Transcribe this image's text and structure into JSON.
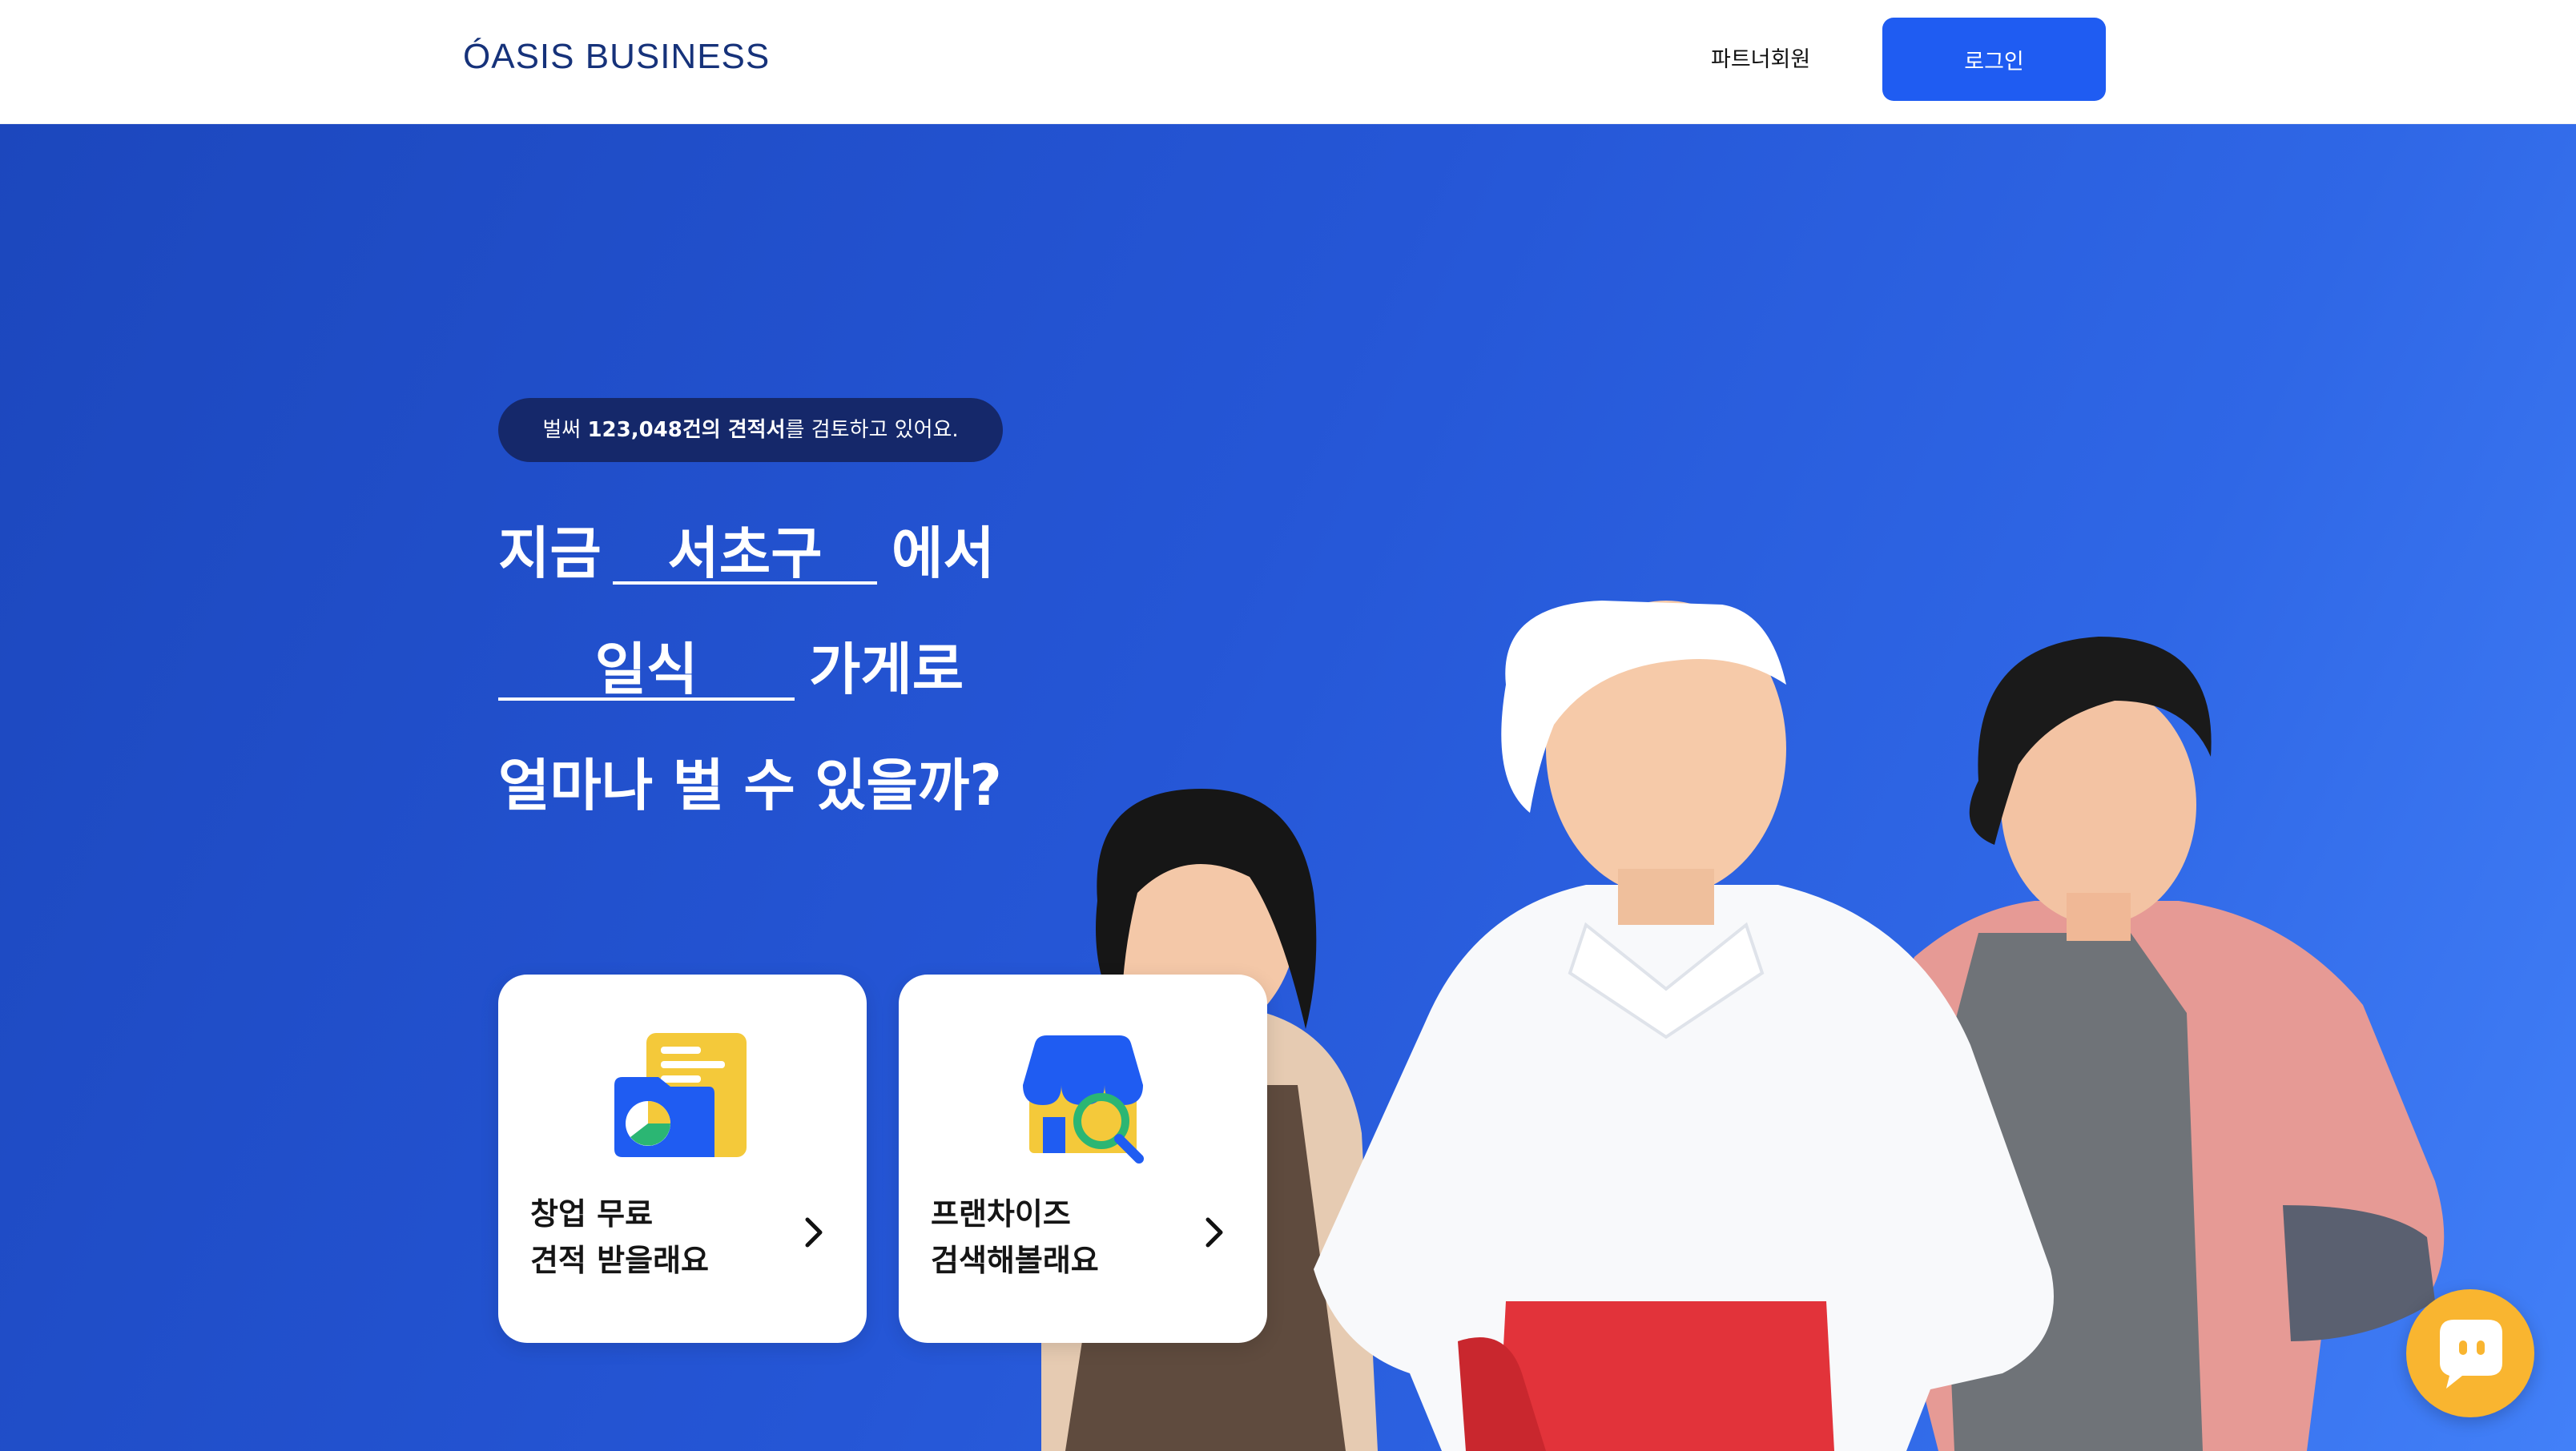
{
  "header": {
    "logo": "ÓASIS BUSINESS",
    "partner_link": "파트너회원",
    "login_button": "로그인"
  },
  "hero": {
    "badge": {
      "prefix": "벌써 ",
      "highlight": "123,048건의 견적서",
      "suffix": "를 검토하고 있어요."
    },
    "line1_prefix": "지금",
    "region_value": "서초구",
    "line1_suffix": "에서",
    "category_value": "일식",
    "line2_suffix": "가게로",
    "line3": "얼마나 벌 수 있을까?"
  },
  "cards": [
    {
      "line1": "창업 무료",
      "line2": "견적 받을래요",
      "icon": "document-chart-icon"
    },
    {
      "line1": "프랜차이즈",
      "line2": "검색해볼래요",
      "icon": "store-search-icon"
    }
  ],
  "colors": {
    "brand_blue": "#1f5cf2",
    "badge_navy": "#15286a",
    "chat_yellow": "#f9b530"
  }
}
